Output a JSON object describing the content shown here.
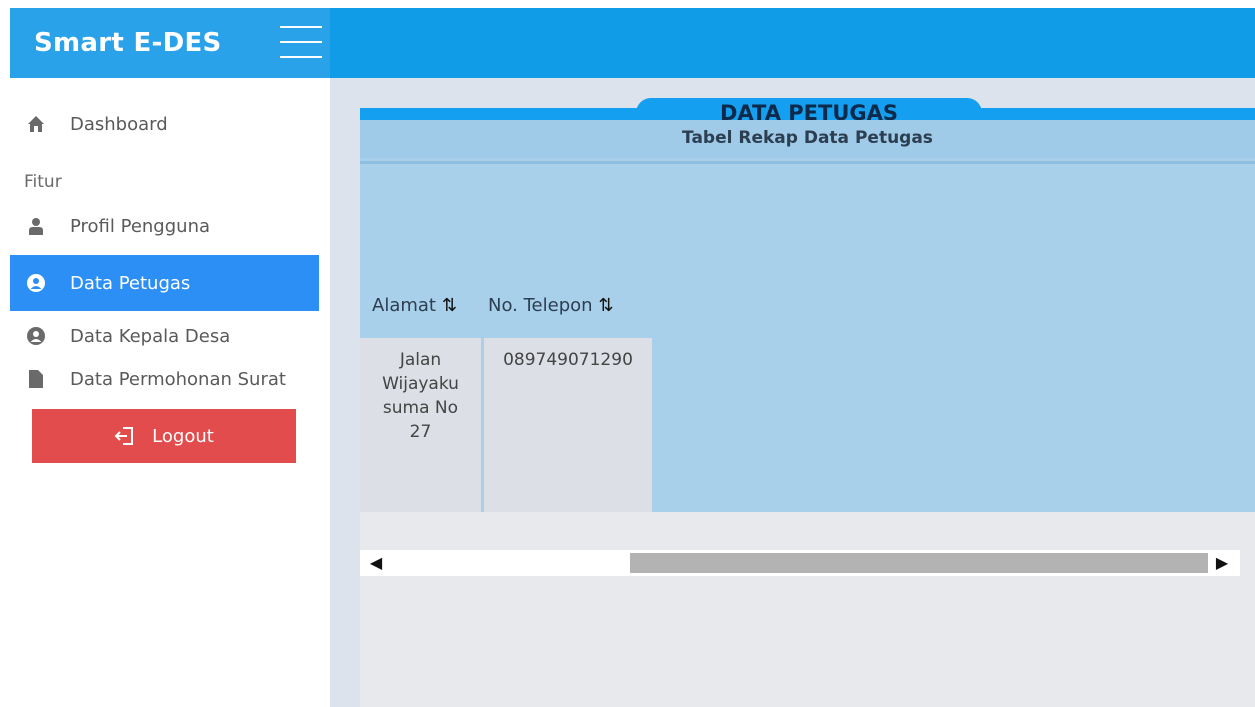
{
  "app": {
    "title": "Smart E-DES"
  },
  "sidebar": {
    "section_label": "Fitur",
    "items": [
      {
        "label": "Dashboard",
        "icon": "home-icon"
      },
      {
        "label": "Profil Pengguna",
        "icon": "user-icon"
      },
      {
        "label": "Data  Petugas",
        "icon": "user-circle-icon",
        "active": true
      },
      {
        "label": "Data  Kepala Desa",
        "icon": "user-circle-icon"
      },
      {
        "label": "Data Permohonan Surat",
        "icon": "file-icon"
      }
    ],
    "logout_label": "Logout"
  },
  "main": {
    "page_title": "DATA PETUGAS",
    "card_title": "Tabel Rekap Data Petugas",
    "table": {
      "columns": [
        "Alamat",
        "No. Telepon"
      ],
      "rows": [
        [
          "Jalan Wijayaku suma No 27",
          "089749071290"
        ]
      ]
    }
  },
  "colors": {
    "brand": "#2aa2ea",
    "topbar": "#119ce8",
    "active_nav": "#2b8ff5",
    "logout": "#e24c4c",
    "table_bg": "#a9d0ea"
  }
}
